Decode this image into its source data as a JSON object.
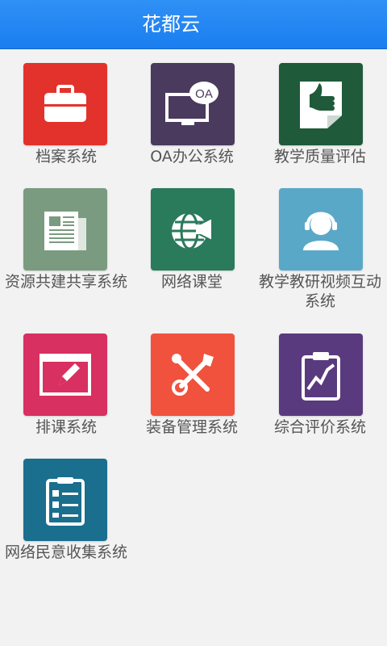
{
  "header": {
    "title": "花都云"
  },
  "colors": {
    "header_bg": "#1a7ef0",
    "background": "#f2f2f2"
  },
  "apps": [
    {
      "label": "档案系统",
      "icon": "briefcase-icon",
      "color": "#e3322b"
    },
    {
      "label": "OA办公系统",
      "icon": "oa-monitor-icon",
      "color": "#4a3a5e"
    },
    {
      "label": "教学质量评估",
      "icon": "thumbs-up-icon",
      "color": "#1f5a3a"
    },
    {
      "label": "资源共建共享系统",
      "icon": "newspaper-icon",
      "color": "#7a9b80"
    },
    {
      "label": "网络课堂",
      "icon": "globe-megaphone-icon",
      "color": "#2a7a5c"
    },
    {
      "label": "教学教研视频互动系统",
      "icon": "headset-user-icon",
      "color": "#5aa8c8"
    },
    {
      "label": "排课系统",
      "icon": "edit-board-icon",
      "color": "#d83060"
    },
    {
      "label": "装备管理系统",
      "icon": "tools-icon",
      "color": "#f0523e"
    },
    {
      "label": "综合评价系统",
      "icon": "chart-clipboard-icon",
      "color": "#5a3a7e"
    },
    {
      "label": "网络民意收集系统",
      "icon": "checklist-icon",
      "color": "#1a6e8e"
    }
  ]
}
